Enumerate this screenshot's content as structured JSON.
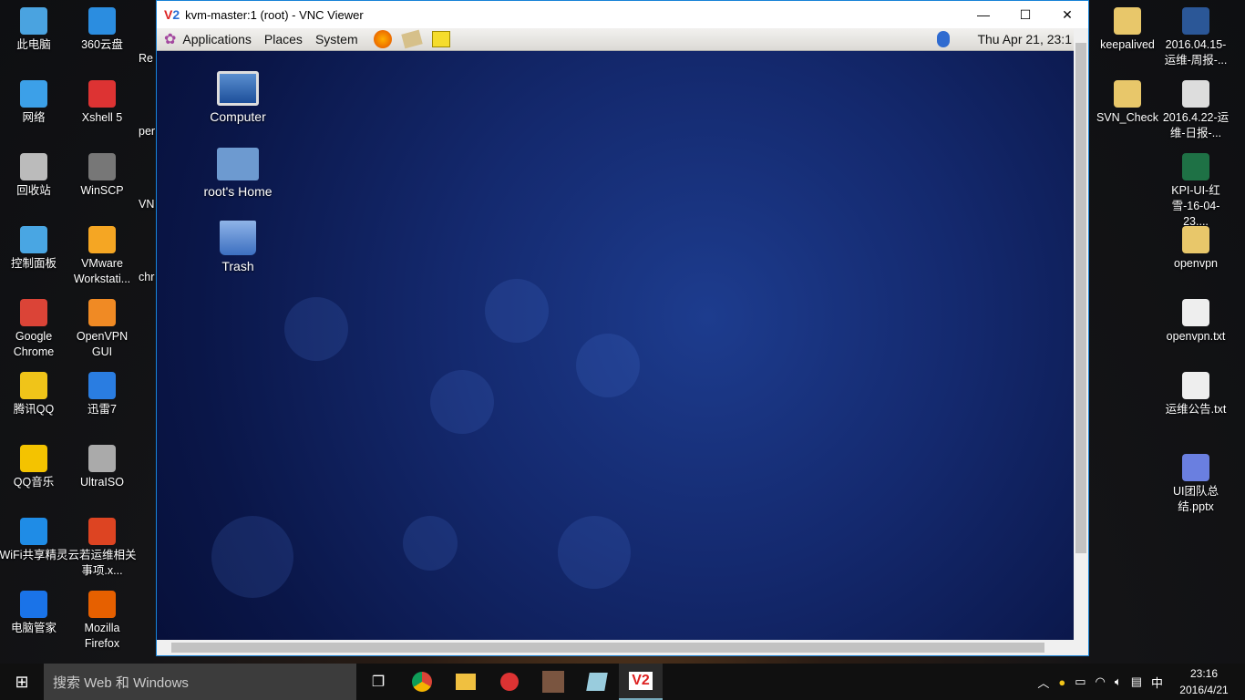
{
  "desktop_left": [
    {
      "label": "此电脑",
      "color": "#4aa3e0"
    },
    {
      "label": "360云盘",
      "color": "#2b8de0"
    },
    {
      "label": "网络",
      "color": "#3ca0e8"
    },
    {
      "label": "Xshell 5",
      "color": "#d33"
    },
    {
      "label": "回收站",
      "color": "#bbb"
    },
    {
      "label": "WinSCP",
      "color": "#777"
    },
    {
      "label": "控制面板",
      "color": "#49a6e3"
    },
    {
      "label": "VMware Workstati...",
      "color": "#f5a623"
    },
    {
      "label": "Google Chrome",
      "color": "#db4437"
    },
    {
      "label": "OpenVPN GUI",
      "color": "#f08a24"
    },
    {
      "label": "腾讯QQ",
      "color": "#f0c419"
    },
    {
      "label": "迅雷7",
      "color": "#2a7de1"
    },
    {
      "label": "QQ音乐",
      "color": "#f4c300"
    },
    {
      "label": "UltraISO",
      "color": "#aaa"
    },
    {
      "label": "WiFi共享精灵",
      "color": "#1f8ce6"
    },
    {
      "label": "云若运维相关事项.x...",
      "color": "#d42"
    },
    {
      "label": "电脑管家",
      "color": "#1a73e8"
    },
    {
      "label": "Mozilla Firefox",
      "color": "#e66000"
    }
  ],
  "desktop_partial": [
    "Re",
    "per",
    "VN",
    "chr"
  ],
  "desktop_right": [
    {
      "label": "keepalived",
      "color": "#e8c76a"
    },
    {
      "label": "2016.04.15-运维-周报-...",
      "color": "#2b5797"
    },
    {
      "label": "SVN_Check",
      "color": "#e8c76a"
    },
    {
      "label": "2016.4.22-运维-日报-...",
      "color": "#ddd"
    },
    {
      "label": "KPI-UI-红雪-16-04-23....",
      "color": "#1e7145"
    },
    {
      "label": "openvpn",
      "color": "#e8c76a"
    },
    {
      "label": "openvpn.txt",
      "color": "#eee"
    },
    {
      "label": "运维公告.txt",
      "color": "#eee"
    },
    {
      "label": "UI团队总结.pptx",
      "color": "#6a7fe0"
    }
  ],
  "vnc": {
    "title": "kvm-master:1 (root) - VNC Viewer",
    "logo": "V2",
    "menu": [
      "Applications",
      "Places",
      "System"
    ],
    "clock": "Thu Apr 21, 23:1",
    "icons": [
      {
        "label": "Computer"
      },
      {
        "label": "root's Home"
      },
      {
        "label": "Trash"
      }
    ]
  },
  "taskbar": {
    "search_placeholder": "搜索 Web 和 Windows",
    "ime": "中",
    "time": "23:16",
    "date": "2016/4/21"
  }
}
